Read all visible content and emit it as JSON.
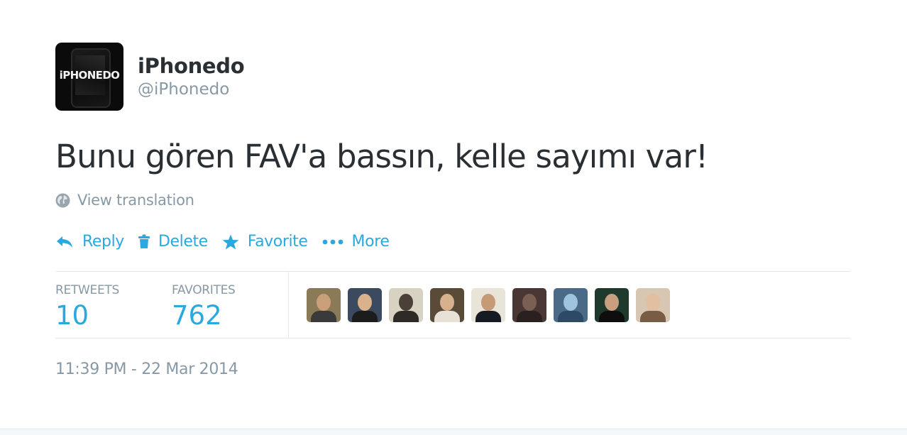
{
  "user": {
    "display_name": "iPhonedo",
    "handle": "@iPhonedo",
    "avatar_text": "iPHONEDO"
  },
  "tweet": {
    "text": "Bunu gören FAV'a bassın, kelle sayımı var!",
    "translate_label": "View translation",
    "timestamp": "11:39 PM - 22 Mar 2014"
  },
  "actions": {
    "reply": "Reply",
    "delete": "Delete",
    "favorite": "Favorite",
    "more": "More"
  },
  "stats": {
    "retweets_label": "RETWEETS",
    "retweets_value": "10",
    "favorites_label": "FAVORITES",
    "favorites_value": "762"
  },
  "colors": {
    "accent": "#2aa9e0",
    "muted": "#8899a6",
    "text": "#292f33",
    "divider": "#e1e8ed"
  },
  "favoriters": [
    {
      "bg": "#8a7a58",
      "skin": "#c9a07a",
      "shirt": "#3a3a3a"
    },
    {
      "bg": "#3b4a5e",
      "skin": "#d8b28a",
      "shirt": "#1c1c1c"
    },
    {
      "bg": "#d8d2c2",
      "skin": "#4a4038",
      "shirt": "#2e2a26"
    },
    {
      "bg": "#5a4a38",
      "skin": "#d7b08e",
      "shirt": "#e8e2d6"
    },
    {
      "bg": "#e9e4d8",
      "skin": "#c59a76",
      "shirt": "#161a22"
    },
    {
      "bg": "#4a3634",
      "skin": "#7a6052",
      "shirt": "#2a2020"
    },
    {
      "bg": "#4b6a88",
      "skin": "#9ec4e0",
      "shirt": "#2c4a66"
    },
    {
      "bg": "#1f3a2c",
      "skin": "#c8a080",
      "shirt": "#0e0e0e"
    },
    {
      "bg": "#d6c6b2",
      "skin": "#e2bfa0",
      "shirt": "#7a5c44"
    }
  ]
}
